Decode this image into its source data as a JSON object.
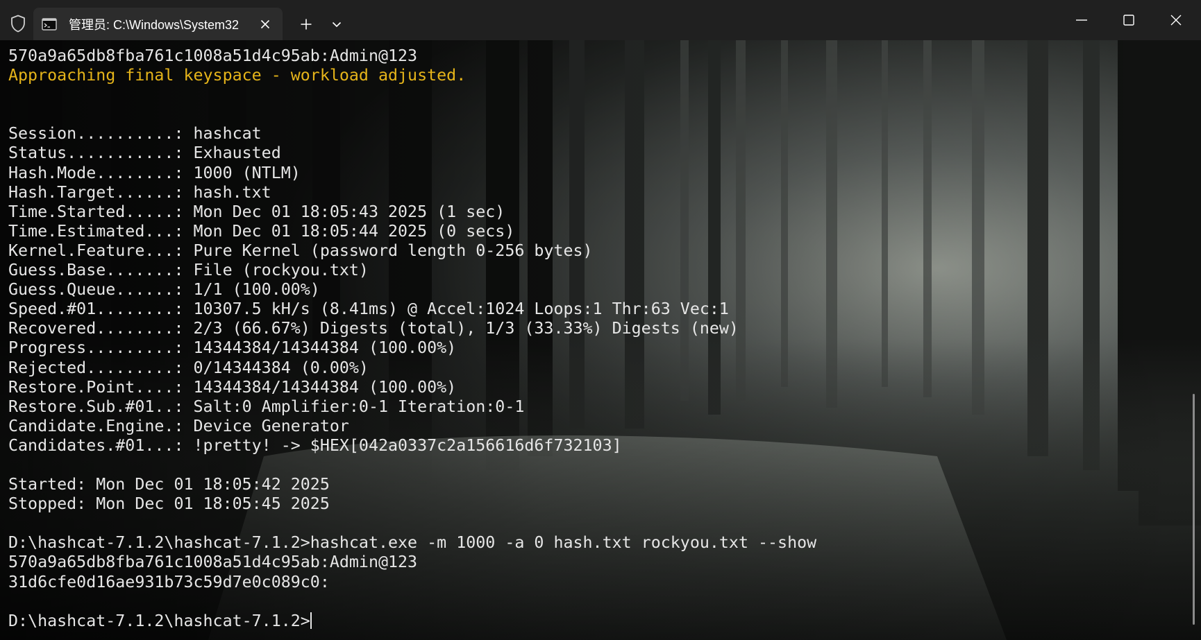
{
  "window": {
    "tab_title": "管理员: C:\\Windows\\System32",
    "accent_color": "#e5b41a",
    "icons": {
      "shield": "shield-icon",
      "terminal": "terminal-icon",
      "tab_close": "close-icon",
      "new_tab": "plus-icon",
      "dropdown": "chevron-down-icon",
      "minimize": "minimize-icon",
      "maximize": "maximize-icon",
      "close": "close-icon"
    }
  },
  "terminal": {
    "lines": [
      {
        "text": "570a9a65db8fba761c1008a51d4c95ab:Admin@123",
        "style": "normal"
      },
      {
        "text": "Approaching final keyspace - workload adjusted.",
        "style": "warn"
      },
      {
        "text": "",
        "style": "normal"
      },
      {
        "text": "",
        "style": "normal"
      },
      {
        "text": "Session..........: hashcat",
        "style": "normal"
      },
      {
        "text": "Status...........: Exhausted",
        "style": "normal"
      },
      {
        "text": "Hash.Mode........: 1000 (NTLM)",
        "style": "normal"
      },
      {
        "text": "Hash.Target......: hash.txt",
        "style": "normal"
      },
      {
        "text": "Time.Started.....: Mon Dec 01 18:05:43 2025 (1 sec)",
        "style": "normal"
      },
      {
        "text": "Time.Estimated...: Mon Dec 01 18:05:44 2025 (0 secs)",
        "style": "normal"
      },
      {
        "text": "Kernel.Feature...: Pure Kernel (password length 0-256 bytes)",
        "style": "normal"
      },
      {
        "text": "Guess.Base.......: File (rockyou.txt)",
        "style": "normal"
      },
      {
        "text": "Guess.Queue......: 1/1 (100.00%)",
        "style": "normal"
      },
      {
        "text": "Speed.#01........: 10307.5 kH/s (8.41ms) @ Accel:1024 Loops:1 Thr:63 Vec:1",
        "style": "normal"
      },
      {
        "text": "Recovered........: 2/3 (66.67%) Digests (total), 1/3 (33.33%) Digests (new)",
        "style": "normal"
      },
      {
        "text": "Progress.........: 14344384/14344384 (100.00%)",
        "style": "normal"
      },
      {
        "text": "Rejected.........: 0/14344384 (0.00%)",
        "style": "normal"
      },
      {
        "text": "Restore.Point....: 14344384/14344384 (100.00%)",
        "style": "normal"
      },
      {
        "text": "Restore.Sub.#01..: Salt:0 Amplifier:0-1 Iteration:0-1",
        "style": "normal"
      },
      {
        "text": "Candidate.Engine.: Device Generator",
        "style": "normal"
      },
      {
        "text": "Candidates.#01...: !pretty! -> $HEX[042a0337c2a156616d6f732103]",
        "style": "normal"
      },
      {
        "text": "",
        "style": "normal"
      },
      {
        "text": "Started: Mon Dec 01 18:05:42 2025",
        "style": "normal"
      },
      {
        "text": "Stopped: Mon Dec 01 18:05:45 2025",
        "style": "normal"
      },
      {
        "text": "",
        "style": "normal"
      },
      {
        "text": "D:\\hashcat-7.1.2\\hashcat-7.1.2>hashcat.exe -m 1000 -a 0 hash.txt rockyou.txt --show",
        "style": "normal"
      },
      {
        "text": "570a9a65db8fba761c1008a51d4c95ab:Admin@123",
        "style": "normal"
      },
      {
        "text": "31d6cfe0d16ae931b73c59d7e0c089c0:",
        "style": "normal"
      },
      {
        "text": "",
        "style": "normal"
      }
    ],
    "prompt": "D:\\hashcat-7.1.2\\hashcat-7.1.2>"
  }
}
